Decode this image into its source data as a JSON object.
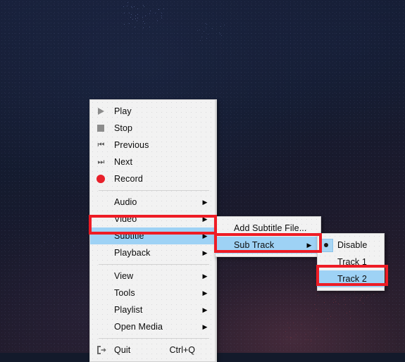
{
  "desktop": {
    "label": "desktop-wallpaper",
    "background_color": "#161f33",
    "accent_color": "#ee1c25"
  },
  "colors": {
    "menu_background": "#f2f2f2",
    "highlight_blue": "#9ed2f5",
    "annotation_red": "#ee1c25",
    "record_red": "#e8202a",
    "icon_gray": "#8c8c8c"
  },
  "main_menu": {
    "name": "media-player-context-menu",
    "groups": [
      {
        "items": [
          {
            "label": "Play",
            "icon": "play-icon",
            "arrow": false,
            "shortcut": "",
            "highlighted": false
          },
          {
            "label": "Stop",
            "icon": "stop-icon",
            "arrow": false,
            "shortcut": "",
            "highlighted": false
          },
          {
            "label": "Previous",
            "icon": "previous-icon",
            "arrow": false,
            "shortcut": "",
            "highlighted": false
          },
          {
            "label": "Next",
            "icon": "next-icon",
            "arrow": false,
            "shortcut": "",
            "highlighted": false
          },
          {
            "label": "Record",
            "icon": "record-icon",
            "arrow": false,
            "shortcut": "",
            "highlighted": false
          }
        ]
      },
      {
        "items": [
          {
            "label": "Audio",
            "icon": "",
            "arrow": true,
            "shortcut": "",
            "highlighted": false
          },
          {
            "label": "Video",
            "icon": "",
            "arrow": true,
            "shortcut": "",
            "highlighted": false
          },
          {
            "label": "Subtitle",
            "icon": "",
            "arrow": true,
            "shortcut": "",
            "highlighted": true
          },
          {
            "label": "Playback",
            "icon": "",
            "arrow": true,
            "shortcut": "",
            "highlighted": false
          }
        ]
      },
      {
        "items": [
          {
            "label": "View",
            "icon": "",
            "arrow": true,
            "shortcut": "",
            "highlighted": false
          },
          {
            "label": "Tools",
            "icon": "",
            "arrow": true,
            "shortcut": "",
            "highlighted": false
          },
          {
            "label": "Playlist",
            "icon": "",
            "arrow": true,
            "shortcut": "",
            "highlighted": false
          },
          {
            "label": "Open Media",
            "icon": "",
            "arrow": true,
            "shortcut": "",
            "highlighted": false
          }
        ]
      },
      {
        "items": [
          {
            "label": "Quit",
            "icon": "exit-icon",
            "arrow": false,
            "shortcut": "Ctrl+Q",
            "highlighted": false
          }
        ]
      }
    ]
  },
  "subtitle_submenu": {
    "name": "subtitle-submenu",
    "items": [
      {
        "label": "Add Subtitle File...",
        "arrow": false,
        "highlighted": false
      },
      {
        "label": "Sub Track",
        "arrow": true,
        "highlighted": true
      }
    ]
  },
  "sub_track_submenu": {
    "name": "sub-track-submenu",
    "items": [
      {
        "label": "Disable",
        "selected": true,
        "highlighted": false
      },
      {
        "label": "Track 1",
        "selected": false,
        "highlighted": false
      },
      {
        "label": "Track 2",
        "selected": false,
        "highlighted": true
      }
    ]
  },
  "annotations": [
    {
      "target": "Subtitle",
      "name": "annotation-subtitle"
    },
    {
      "target": "Sub Track",
      "name": "annotation-sub-track"
    },
    {
      "target": "Track 2",
      "name": "annotation-track-2"
    }
  ]
}
